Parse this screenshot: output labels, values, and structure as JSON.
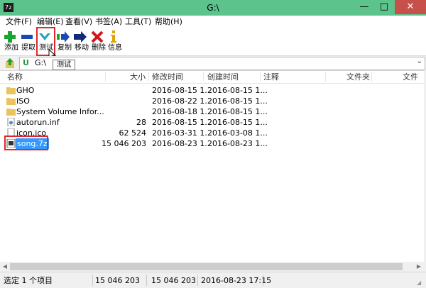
{
  "window": {
    "app_icon": "7z",
    "title": "G:\\",
    "buttons": {
      "minimize": "—",
      "maximize": "□",
      "close": "✕"
    },
    "title_bar_color": "#5cc38c",
    "close_color": "#c7504b"
  },
  "menu": [
    "文件(F)",
    "编辑(E)",
    "查看(V)",
    "书签(A)",
    "工具(T)",
    "帮助(H)"
  ],
  "toolbar": {
    "add": "添加",
    "extract": "提取",
    "test": "测试",
    "copy": "复制",
    "move": "移动",
    "delete": "删除",
    "info": "信息"
  },
  "tooltip": "测试",
  "address": {
    "path": "G:\\"
  },
  "columns": [
    "名称",
    "大小",
    "修改时间",
    "创建时间",
    "注释",
    "文件夹",
    "文件"
  ],
  "files": [
    {
      "icon": "folder-icon",
      "name": "GHO",
      "size": "",
      "modified": "2016-08-15 1...",
      "created": "2016-08-15 1..."
    },
    {
      "icon": "folder-icon",
      "name": "ISO",
      "size": "",
      "modified": "2016-08-22 1...",
      "created": "2016-08-15 1..."
    },
    {
      "icon": "folder-icon",
      "name": "System Volume Infor...",
      "size": "",
      "modified": "2016-08-18 1...",
      "created": "2016-08-15 1..."
    },
    {
      "icon": "settings-file-icon",
      "name": "autorun.inf",
      "size": "28",
      "modified": "2016-08-15 1...",
      "created": "2016-08-15 1..."
    },
    {
      "icon": "file-icon",
      "name": "icon.ico",
      "size": "62 524",
      "modified": "2016-03-31 1...",
      "created": "2016-03-08 1..."
    },
    {
      "icon": "archive-7z-icon",
      "name": "song.7z",
      "size": "15 046 203",
      "modified": "2016-08-23 1...",
      "created": "2016-08-23 1..."
    }
  ],
  "status": {
    "selection": "选定 1 个项目",
    "size": "15 046 203",
    "total": "15 046 203",
    "modified": "2016-08-23 17:15"
  },
  "highlight_color": "#e0282c",
  "selection_color": "#3399ff"
}
